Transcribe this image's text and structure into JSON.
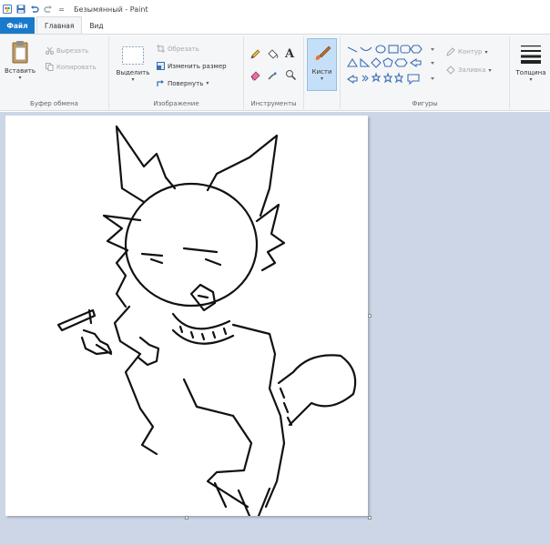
{
  "window": {
    "title": "Безымянный - Paint",
    "qat_overflow": "="
  },
  "tabs": [
    {
      "label": "Файл"
    },
    {
      "label": "Главная"
    },
    {
      "label": "Вид"
    }
  ],
  "ribbon": {
    "clipboard": {
      "paste_label": "Вставить",
      "cut_label": "Вырезать",
      "copy_label": "Копировать",
      "group_label": "Буфер обмена"
    },
    "image": {
      "select_label": "Выделить",
      "crop_label": "Обрезать",
      "resize_label": "Изменить размер",
      "rotate_label": "Повернуть",
      "group_label": "Изображение"
    },
    "tools": {
      "group_label": "Инструменты",
      "text_glyph": "A"
    },
    "brushes": {
      "label": "Кисти"
    },
    "shapes": {
      "outline_label": "Контур",
      "fill_label": "Заливка",
      "group_label": "Фигуры"
    },
    "size": {
      "label": "Толщина"
    }
  },
  "colors": {
    "accent": "#1979ca",
    "workspace": "#ccd6e6",
    "selected": "#c5dff8"
  }
}
